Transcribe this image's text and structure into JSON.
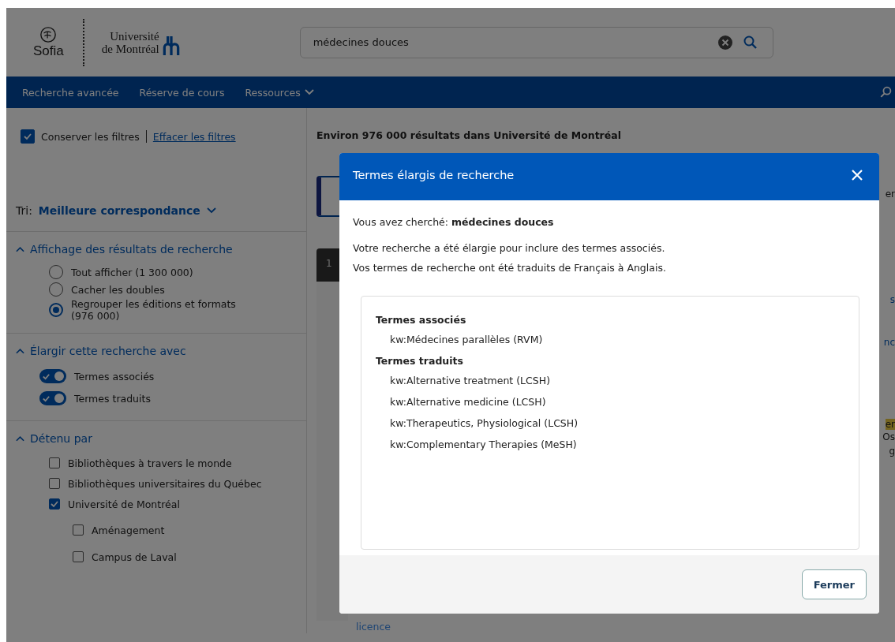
{
  "header": {
    "brand": "Sofia",
    "university_line_1": "Université",
    "university_line_2": "de Montréal",
    "search": {
      "value": "médecines douces"
    }
  },
  "nav": {
    "items": [
      {
        "label": "Recherche avancée",
        "kind": "link"
      },
      {
        "label": "Réserve de cours",
        "kind": "link"
      },
      {
        "label": "Ressources",
        "kind": "dropdown"
      }
    ]
  },
  "filters_bar": {
    "keep_filters": {
      "label": "Conserver les filtres",
      "checked": true
    },
    "clear_link": "Effacer les filtres",
    "results_summary": "Environ 976 000 résultats dans Université de Montréal"
  },
  "sidebar": {
    "sort_label": "Tri:",
    "sort_value": "Meilleure correspondance",
    "sections": [
      {
        "title": "Affichage des résultats de recherche",
        "expanded": true,
        "items": [
          {
            "kind": "radio",
            "label": "Tout afficher (1 300 000)",
            "selected": false
          },
          {
            "kind": "radio",
            "label": "Cacher les doubles",
            "selected": false
          },
          {
            "kind": "radio",
            "label": "Regrouper les éditions et formats (976 000)",
            "selected": true
          }
        ]
      },
      {
        "title": "Élargir cette recherche avec",
        "expanded": true,
        "items": [
          {
            "kind": "toggle",
            "label": "Termes associés",
            "on": true
          },
          {
            "kind": "toggle",
            "label": "Termes traduits",
            "on": true
          }
        ]
      },
      {
        "title": "Détenu par",
        "expanded": true,
        "items": [
          {
            "kind": "checkbox",
            "label": "Bibliothèques à travers le monde",
            "checked": false
          },
          {
            "kind": "checkbox",
            "label": "Bibliothèques universitaires du Québec",
            "checked": false
          },
          {
            "kind": "checkbox",
            "label": "Université de Montréal",
            "checked": true,
            "children": [
              {
                "kind": "checkbox",
                "label": "Aménagement",
                "checked": false
              },
              {
                "kind": "checkbox",
                "label": "Campus de Laval",
                "checked": false
              }
            ]
          }
        ]
      }
    ]
  },
  "results_background": {
    "tab_number": "1",
    "fragments": [
      "er",
      "s",
      "nc",
      "er",
      "Os",
      "g"
    ],
    "bottom_text": "licence"
  },
  "dialog": {
    "title": "Termes élargis de recherche",
    "searched": "Vous avez cherché: **médecines douces**",
    "messages": [
      "Votre recherche a été élargie pour inclure des termes associés.",
      "Vos termes de recherche ont été traduits de Français à Anglais."
    ],
    "groups": [
      {
        "title": "Termes associés",
        "terms": [
          "kw:Médecines parallèles (RVM)"
        ]
      },
      {
        "title": "Termes traduits",
        "terms": [
          "kw:Alternative treatment (LCSH)",
          "kw:Alternative medicine (LCSH)",
          "kw:Therapeutics, Physiological (LCSH)",
          "kw:Complementary Therapies (MeSH)"
        ]
      }
    ],
    "close_button": "Fermer"
  }
}
